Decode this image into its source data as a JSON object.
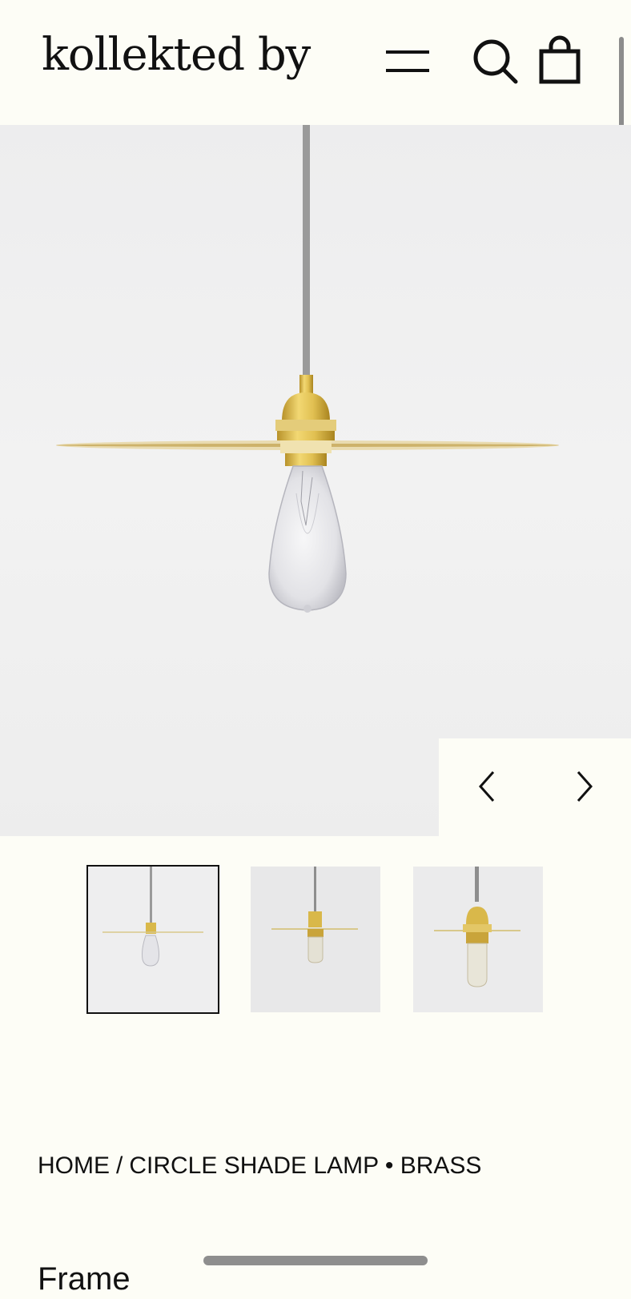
{
  "header": {
    "logo_text": "kollekted by",
    "menu_icon": "hamburger-menu-icon",
    "search_icon": "search-icon",
    "cart_icon": "shopping-bag-icon"
  },
  "gallery": {
    "main_image": "circle-shade-brass-pendant-lamp",
    "prev_icon": "chevron-left-icon",
    "next_icon": "chevron-right-icon",
    "thumbnails": [
      {
        "image": "lamp-front-view",
        "selected": true
      },
      {
        "image": "lamp-side-view",
        "selected": false
      },
      {
        "image": "lamp-closeup-view",
        "selected": false
      }
    ]
  },
  "breadcrumb": {
    "home": "HOME",
    "separator": "/",
    "current": "CIRCLE SHADE LAMP • BRASS"
  },
  "product": {
    "partial_label": "Frame"
  },
  "colors": {
    "background": "#FDFDF6",
    "image_bg": "#EEEEEF",
    "brass": "#D8B84A",
    "text": "#111111",
    "cord": "#9A9A9A"
  }
}
